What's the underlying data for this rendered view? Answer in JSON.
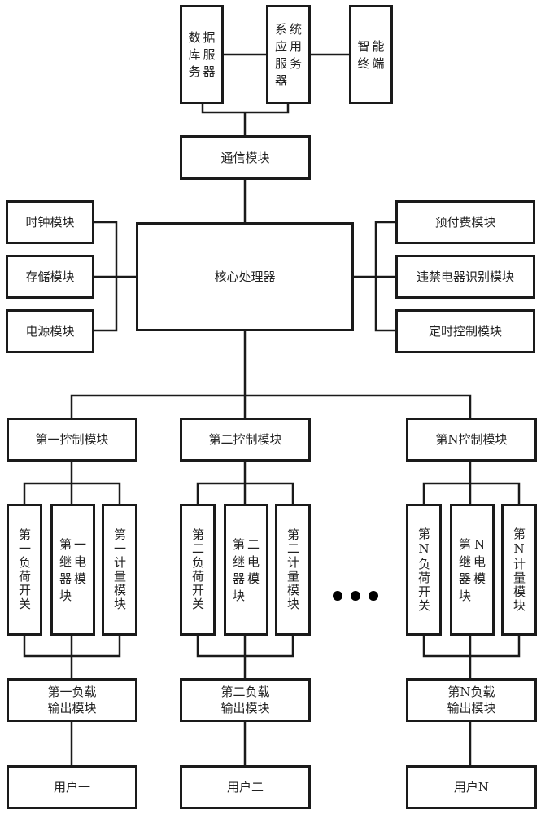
{
  "diagram": {
    "servers": {
      "database_server": "数据库服务器",
      "system_app_server": "系统应用服务器",
      "smart_terminal": "智能终端"
    },
    "communication_module": "通信模块",
    "core_processor": "核心处理器",
    "left_modules": [
      "时钟模块",
      "存储模块",
      "电源模块"
    ],
    "right_modules": [
      "预付费模块",
      "违禁电器识别模块",
      "定时控制模块"
    ],
    "channels": [
      {
        "control_module": "第一控制模块",
        "load_switch": "第一负荷开关",
        "relay_module": "第一继电器模块",
        "metering_module": "第一计量模块",
        "load_output_module": "第一负载\n输出模块",
        "user": "用户一"
      },
      {
        "control_module": "第二控制模块",
        "load_switch": "第二负荷开关",
        "relay_module": "第二继电器模块",
        "metering_module": "第二计量模块",
        "load_output_module": "第二负载\n输出模块",
        "user": "用户二"
      },
      {
        "control_module": "第N控制模块",
        "load_switch": "第N负荷开关",
        "relay_module": "第N继电器模块",
        "metering_module": "第N计量模块",
        "load_output_module": "第N负载\n输出模块",
        "user": "用户N"
      }
    ],
    "ellipsis": "• • •"
  }
}
